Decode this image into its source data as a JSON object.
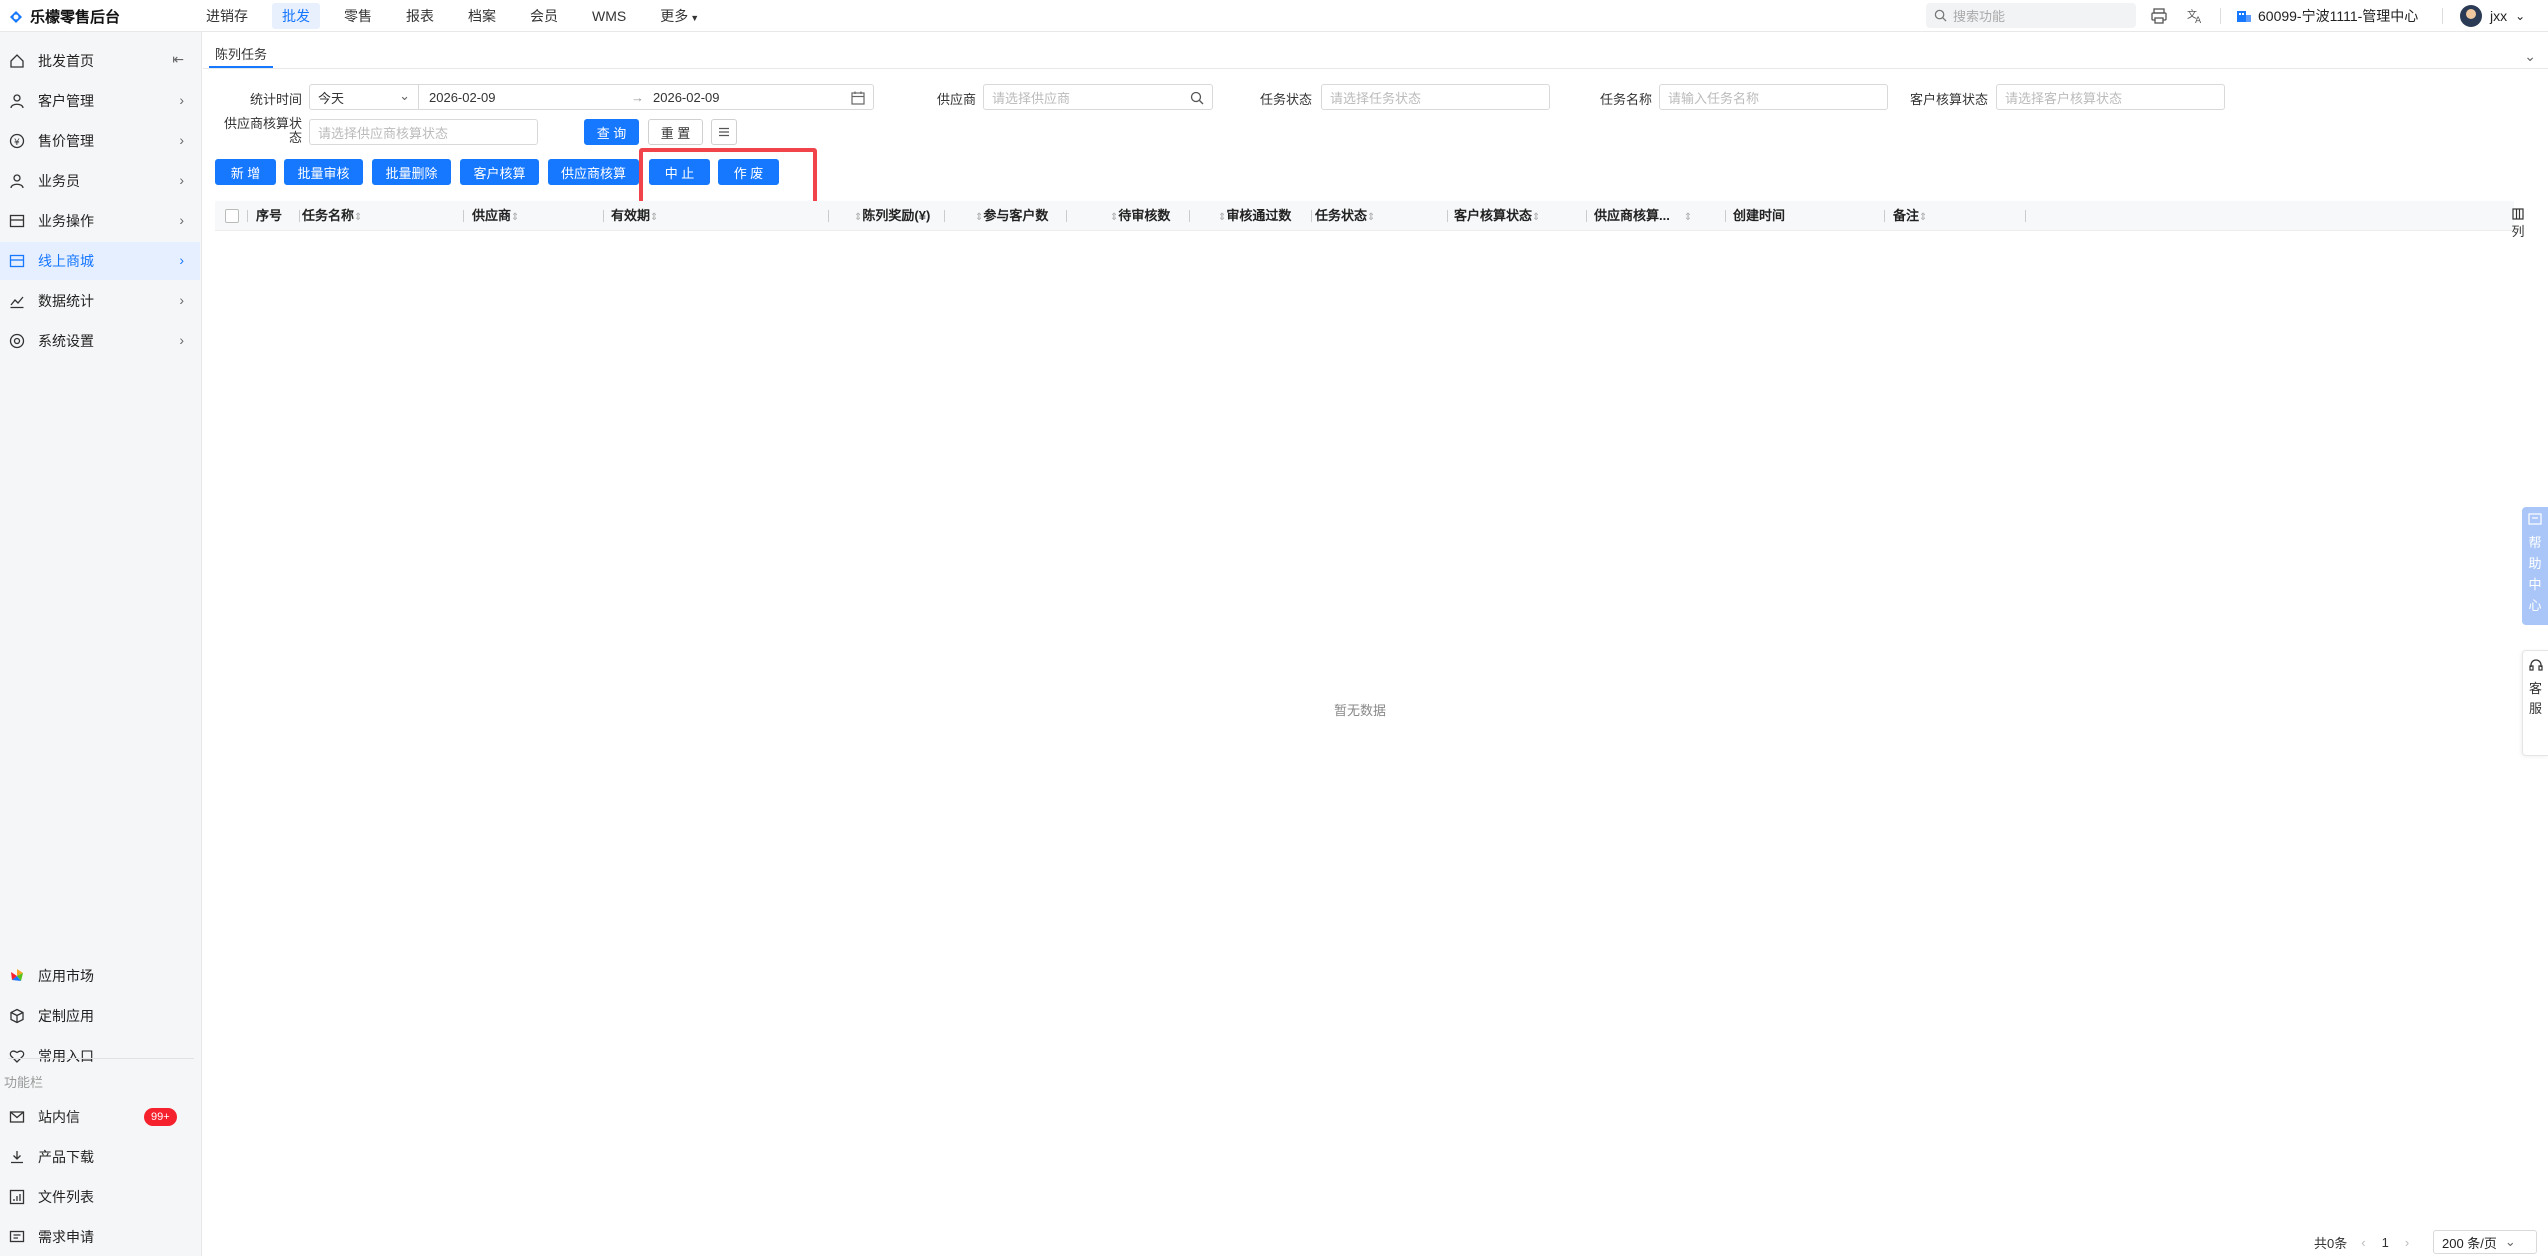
{
  "app": {
    "brand": "乐檬零售后台",
    "nav": [
      "进销存",
      "批发",
      "零售",
      "报表",
      "档案",
      "会员",
      "WMS",
      "更多"
    ],
    "active_nav": "批发",
    "search_placeholder": "搜索功能",
    "org": "60099-宁波1111-管理中心",
    "user": "jxx"
  },
  "sidebar": {
    "items": [
      {
        "label": "批发首页",
        "icon": "home-icon"
      },
      {
        "label": "客户管理",
        "icon": "user-icon"
      },
      {
        "label": "售价管理",
        "icon": "price-icon"
      },
      {
        "label": "业务员",
        "icon": "person-icon"
      },
      {
        "label": "业务操作",
        "icon": "panel-icon"
      },
      {
        "label": "线上商城",
        "icon": "shop-icon"
      },
      {
        "label": "数据统计",
        "icon": "chart-icon"
      },
      {
        "label": "系统设置",
        "icon": "settings-icon"
      }
    ],
    "active_item": "线上商城",
    "bottom_items": [
      {
        "label": "应用市场",
        "icon": "app-market-icon"
      },
      {
        "label": "定制应用",
        "icon": "cube-icon"
      },
      {
        "label": "常用入口",
        "icon": "heart-icon"
      }
    ],
    "section_title": "功能栏",
    "func_items": [
      {
        "label": "站内信",
        "icon": "mail-icon",
        "badge": "99+"
      },
      {
        "label": "产品下载",
        "icon": "download-icon"
      },
      {
        "label": "文件列表",
        "icon": "file-list-icon"
      },
      {
        "label": "需求申请",
        "icon": "request-icon"
      }
    ]
  },
  "page": {
    "tab": "陈列任务"
  },
  "filters": {
    "stat_time_label": "统计时间",
    "stat_time_value": "今天",
    "date_start": "2026-02-09",
    "date_end": "2026-02-09",
    "date_arrow": "→",
    "supplier_label": "供应商",
    "supplier_placeholder": "请选择供应商",
    "task_status_label": "任务状态",
    "task_status_placeholder": "请选择任务状态",
    "task_name_label": "任务名称",
    "task_name_placeholder": "请输入任务名称",
    "customer_check_label": "客户核算状态",
    "customer_check_placeholder": "请选择客户核算状态",
    "supplier_check_label_1": "供应商核算状",
    "supplier_check_label_2": "态",
    "supplier_check_placeholder": "请选择供应商核算状态",
    "query": "查 询",
    "reset": "重 置"
  },
  "actions": [
    "新 增",
    "批量审核",
    "批量删除",
    "客户核算",
    "供应商核算",
    "中 止",
    "作 废"
  ],
  "table": {
    "columns": [
      "序号",
      "任务名称",
      "供应商",
      "有效期",
      "陈列奖励(¥)",
      "参与客户数",
      "待审核数",
      "审核通过数",
      "任务状态",
      "客户核算状态",
      "供应商核算...",
      "创建时间",
      "备注"
    ],
    "empty": "暂无数据",
    "column_toggle": "列"
  },
  "float": {
    "help": [
      "帮",
      "助",
      "中",
      "心"
    ],
    "service": [
      "客",
      "服"
    ]
  },
  "pagination": {
    "total": "共0条",
    "current": "1",
    "size": "200 条/页"
  },
  "colors": {
    "primary": "#1677ff",
    "highlight": "#f0434a",
    "badge": "#f5222d"
  }
}
